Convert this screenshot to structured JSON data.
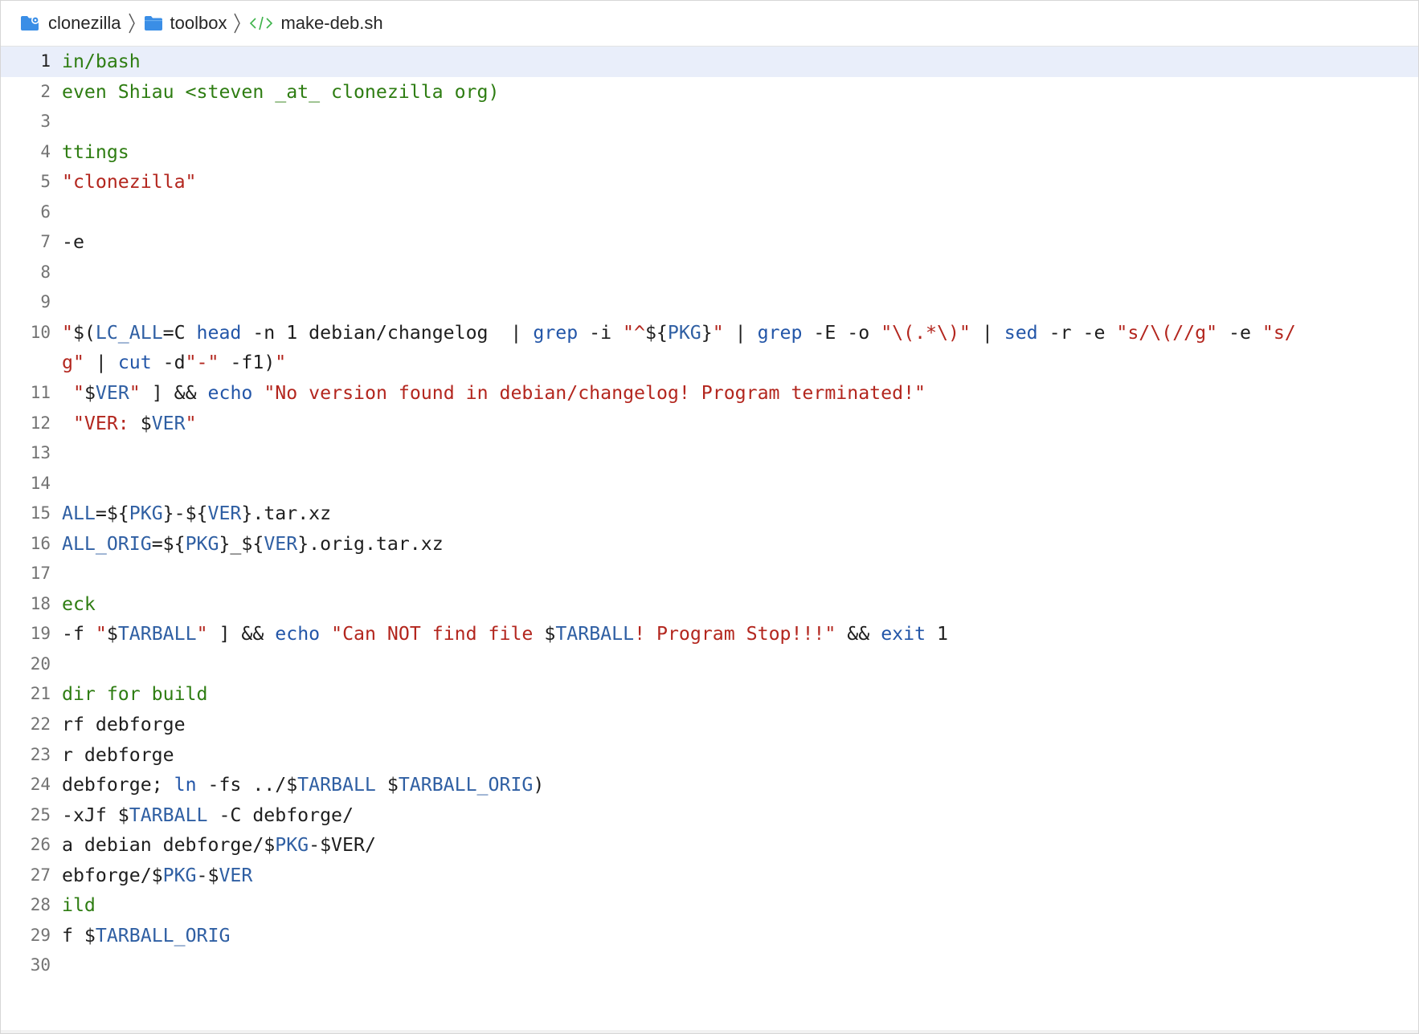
{
  "breadcrumb": {
    "items": [
      {
        "label": "clonezilla",
        "icon": "gear-folder-icon"
      },
      {
        "label": "toolbox",
        "icon": "folder-icon"
      },
      {
        "label": "make-deb.sh",
        "icon": "code-tag-icon"
      }
    ]
  },
  "colors": {
    "comment": "#2e7d12",
    "string": "#b3261e",
    "variable": "#2f5fa3",
    "command": "#2356a8",
    "folder": "#3a8ee6",
    "code_icon": "#3db34a",
    "current_line": "#e9eefa"
  },
  "editor": {
    "current_line": 1,
    "lines": [
      {
        "n": "1",
        "tokens": [
          {
            "t": "c",
            "v": "in/bash"
          }
        ]
      },
      {
        "n": "2",
        "tokens": [
          {
            "t": "c",
            "v": "even Shiau <steven _at_ clonezilla org)"
          }
        ]
      },
      {
        "n": "3",
        "tokens": []
      },
      {
        "n": "4",
        "tokens": [
          {
            "t": "c",
            "v": "ttings"
          }
        ]
      },
      {
        "n": "5",
        "tokens": [
          {
            "t": "s",
            "v": "\"clonezilla\""
          }
        ]
      },
      {
        "n": "6",
        "tokens": []
      },
      {
        "n": "7",
        "tokens": [
          {
            "t": "p",
            "v": "-e"
          }
        ]
      },
      {
        "n": "8",
        "tokens": []
      },
      {
        "n": "9",
        "tokens": []
      },
      {
        "n": "10",
        "tokens": [
          {
            "t": "s",
            "v": "\""
          },
          {
            "t": "p",
            "v": "$("
          },
          {
            "t": "v",
            "v": "LC_ALL"
          },
          {
            "t": "p",
            "v": "=C "
          },
          {
            "t": "k",
            "v": "head"
          },
          {
            "t": "p",
            "v": " -n 1 debian/changelog  | "
          },
          {
            "t": "k",
            "v": "grep"
          },
          {
            "t": "p",
            "v": " -i "
          },
          {
            "t": "s",
            "v": "\"^"
          },
          {
            "t": "p",
            "v": "${"
          },
          {
            "t": "v",
            "v": "PKG"
          },
          {
            "t": "p",
            "v": "}"
          },
          {
            "t": "s",
            "v": "\""
          },
          {
            "t": "p",
            "v": " | "
          },
          {
            "t": "k",
            "v": "grep"
          },
          {
            "t": "p",
            "v": " -E -o "
          },
          {
            "t": "s",
            "v": "\"\\(.*\\)\""
          },
          {
            "t": "p",
            "v": " | "
          },
          {
            "t": "k",
            "v": "sed"
          },
          {
            "t": "p",
            "v": " -r -e "
          },
          {
            "t": "s",
            "v": "\"s/\\(//g\""
          },
          {
            "t": "p",
            "v": " -e "
          },
          {
            "t": "s",
            "v": "\"s/"
          }
        ]
      },
      {
        "n": "",
        "tokens": [
          {
            "t": "s",
            "v": "g\""
          },
          {
            "t": "p",
            "v": " | "
          },
          {
            "t": "k",
            "v": "cut"
          },
          {
            "t": "p",
            "v": " -d"
          },
          {
            "t": "s",
            "v": "\"-\""
          },
          {
            "t": "p",
            "v": " -f1)"
          },
          {
            "t": "s",
            "v": "\""
          }
        ]
      },
      {
        "n": "11",
        "tokens": [
          {
            "t": "p",
            "v": " "
          },
          {
            "t": "s",
            "v": "\""
          },
          {
            "t": "p",
            "v": "$"
          },
          {
            "t": "v",
            "v": "VER"
          },
          {
            "t": "s",
            "v": "\""
          },
          {
            "t": "p",
            "v": " ] && "
          },
          {
            "t": "k",
            "v": "echo"
          },
          {
            "t": "p",
            "v": " "
          },
          {
            "t": "s",
            "v": "\"No version found in debian/changelog! Program terminated!\""
          }
        ]
      },
      {
        "n": "12",
        "tokens": [
          {
            "t": "p",
            "v": " "
          },
          {
            "t": "s",
            "v": "\"VER: "
          },
          {
            "t": "p",
            "v": "$"
          },
          {
            "t": "v",
            "v": "VER"
          },
          {
            "t": "s",
            "v": "\""
          }
        ]
      },
      {
        "n": "13",
        "tokens": []
      },
      {
        "n": "14",
        "tokens": []
      },
      {
        "n": "15",
        "tokens": [
          {
            "t": "v",
            "v": "ALL"
          },
          {
            "t": "p",
            "v": "=${"
          },
          {
            "t": "v",
            "v": "PKG"
          },
          {
            "t": "p",
            "v": "}-${"
          },
          {
            "t": "v",
            "v": "VER"
          },
          {
            "t": "p",
            "v": "}.tar.xz"
          }
        ]
      },
      {
        "n": "16",
        "tokens": [
          {
            "t": "v",
            "v": "ALL_ORIG"
          },
          {
            "t": "p",
            "v": "=${"
          },
          {
            "t": "v",
            "v": "PKG"
          },
          {
            "t": "p",
            "v": "}_${"
          },
          {
            "t": "v",
            "v": "VER"
          },
          {
            "t": "p",
            "v": "}.orig.tar.xz"
          }
        ]
      },
      {
        "n": "17",
        "tokens": []
      },
      {
        "n": "18",
        "tokens": [
          {
            "t": "c",
            "v": "eck"
          }
        ]
      },
      {
        "n": "19",
        "tokens": [
          {
            "t": "p",
            "v": "-f "
          },
          {
            "t": "s",
            "v": "\""
          },
          {
            "t": "p",
            "v": "$"
          },
          {
            "t": "v",
            "v": "TARBALL"
          },
          {
            "t": "s",
            "v": "\""
          },
          {
            "t": "p",
            "v": " ] && "
          },
          {
            "t": "k",
            "v": "echo"
          },
          {
            "t": "p",
            "v": " "
          },
          {
            "t": "s",
            "v": "\"Can NOT find file "
          },
          {
            "t": "p",
            "v": "$"
          },
          {
            "t": "v",
            "v": "TARBALL"
          },
          {
            "t": "s",
            "v": "! Program Stop!!!\""
          },
          {
            "t": "p",
            "v": " && "
          },
          {
            "t": "k",
            "v": "exit"
          },
          {
            "t": "p",
            "v": " 1"
          }
        ]
      },
      {
        "n": "20",
        "tokens": []
      },
      {
        "n": "21",
        "tokens": [
          {
            "t": "c",
            "v": "dir for build"
          }
        ]
      },
      {
        "n": "22",
        "tokens": [
          {
            "t": "p",
            "v": "rf debforge"
          }
        ]
      },
      {
        "n": "23",
        "tokens": [
          {
            "t": "p",
            "v": "r debforge"
          }
        ]
      },
      {
        "n": "24",
        "tokens": [
          {
            "t": "p",
            "v": "debforge; "
          },
          {
            "t": "k",
            "v": "ln"
          },
          {
            "t": "p",
            "v": " -fs ../$"
          },
          {
            "t": "v",
            "v": "TARBALL"
          },
          {
            "t": "p",
            "v": " $"
          },
          {
            "t": "v",
            "v": "TARBALL_ORIG"
          },
          {
            "t": "p",
            "v": ")"
          }
        ]
      },
      {
        "n": "25",
        "tokens": [
          {
            "t": "p",
            "v": "-xJf $"
          },
          {
            "t": "v",
            "v": "TARBALL"
          },
          {
            "t": "p",
            "v": " -C debforge/"
          }
        ]
      },
      {
        "n": "26",
        "tokens": [
          {
            "t": "p",
            "v": "a debian debforge/$"
          },
          {
            "t": "v",
            "v": "PKG"
          },
          {
            "t": "p",
            "v": "-$VER/"
          }
        ]
      },
      {
        "n": "27",
        "tokens": [
          {
            "t": "p",
            "v": "ebforge/$"
          },
          {
            "t": "v",
            "v": "PKG"
          },
          {
            "t": "p",
            "v": "-$"
          },
          {
            "t": "v",
            "v": "VER"
          }
        ]
      },
      {
        "n": "28",
        "tokens": [
          {
            "t": "c",
            "v": "ild"
          }
        ]
      },
      {
        "n": "29",
        "tokens": [
          {
            "t": "p",
            "v": "f $"
          },
          {
            "t": "v",
            "v": "TARBALL_ORIG"
          }
        ]
      },
      {
        "n": "30",
        "tokens": []
      }
    ]
  }
}
